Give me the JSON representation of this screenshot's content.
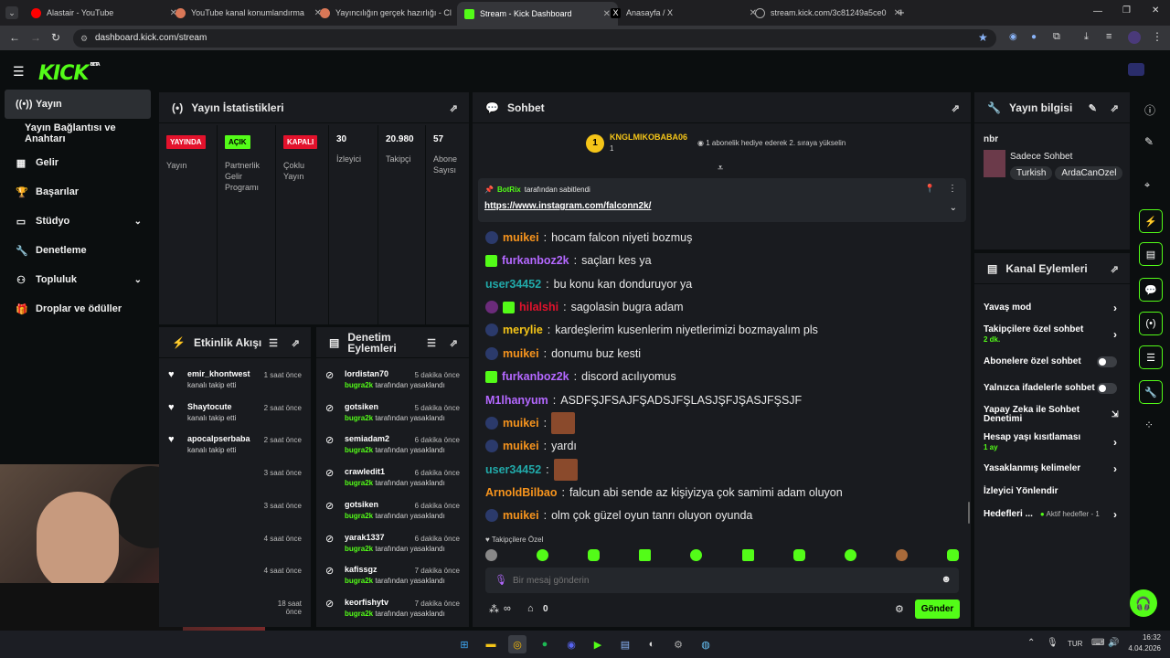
{
  "browser": {
    "tabs": [
      {
        "title": "Alastair - YouTube",
        "color": "#ff0000"
      },
      {
        "title": "YouTube kanal konumlandırma",
        "color": "#d97757"
      },
      {
        "title": "Yayıncılığın gerçek hazırlığı - Cl",
        "color": "#d97757"
      },
      {
        "title": "Stream - Kick Dashboard",
        "color": "#53fc18"
      },
      {
        "title": "Anasayfa / X",
        "color": "#ffffff"
      },
      {
        "title": "stream.kick.com/3c81249a5ce0",
        "color": "#5f6368"
      }
    ],
    "url": "dashboard.kick.com/stream"
  },
  "kick": {
    "logo": "KICK",
    "beta": "BETA"
  },
  "nav": {
    "items": [
      {
        "label": "Yayın",
        "icon": "broadcast-icon"
      },
      {
        "label": "Yayın Bağlantısı ve Anahtarı"
      },
      {
        "label": "Gelir",
        "icon": "chart-icon"
      },
      {
        "label": "Başarılar",
        "icon": "trophy-icon"
      },
      {
        "label": "Stüdyo",
        "icon": "studio-icon"
      },
      {
        "label": "Denetleme",
        "icon": "wrench-icon"
      },
      {
        "label": "Topluluk",
        "icon": "people-icon"
      },
      {
        "label": "Droplar ve ödüller",
        "icon": "gift-icon"
      }
    ]
  },
  "stats": {
    "title": "Yayın İstatistikleri",
    "cells": [
      {
        "badge": "YAYINDA",
        "badge_color": "#e3122c",
        "label": "Yayın"
      },
      {
        "badge": "AÇIK",
        "badge_color": "#53fc18",
        "label": "Partnerlik Gelir Programı"
      },
      {
        "badge": "KAPALI",
        "badge_color": "#e3122c",
        "label": "Çoklu Yayın"
      },
      {
        "value": "30",
        "label": "İzleyici"
      },
      {
        "value": "20.980",
        "label": "Takipçi"
      },
      {
        "value": "57",
        "label": "Abone Sayısı"
      }
    ]
  },
  "activity": {
    "title": "Etkinlik Akışı",
    "rows": [
      {
        "name": "emir_khontwest",
        "sub": "kanalı takip etti",
        "time": "1 saat önce"
      },
      {
        "name": "Shaytocute",
        "sub": "kanalı takip etti",
        "time": "2 saat önce"
      },
      {
        "name": "apocalpserbaba",
        "sub": "kanalı takip etti",
        "time": "2 saat önce"
      },
      {
        "time": "3 saat önce"
      },
      {
        "time": "3 saat önce"
      },
      {
        "time": "4 saat önce"
      },
      {
        "time": "4 saat önce"
      },
      {
        "time": "18 saat önce"
      }
    ]
  },
  "mod": {
    "title": "Denetim Eylemleri",
    "rows": [
      {
        "name": "lordistan70",
        "mod": "bugra2k",
        "sub": "tarafından yasaklandı",
        "time": "5 dakika önce"
      },
      {
        "name": "gotsiken",
        "mod": "bugra2k",
        "sub": "tarafından yasaklandı",
        "time": "5 dakika önce"
      },
      {
        "name": "semiadam2",
        "mod": "bugra2k",
        "sub": "tarafından yasaklandı",
        "time": "6 dakika önce"
      },
      {
        "name": "crawledit1",
        "mod": "bugra2k",
        "sub": "tarafından yasaklandı",
        "time": "6 dakika önce"
      },
      {
        "name": "gotsiken",
        "mod": "bugra2k",
        "sub": "tarafından yasaklandı",
        "time": "6 dakika önce"
      },
      {
        "name": "yarak1337",
        "mod": "bugra2k",
        "sub": "tarafından yasaklandı",
        "time": "6 dakika önce"
      },
      {
        "name": "kafissgz",
        "mod": "bugra2k",
        "sub": "tarafından yasaklandı",
        "time": "7 dakika önce"
      },
      {
        "name": "keorfishytv",
        "mod": "bugra2k",
        "sub": "tarafından yasaklandı",
        "time": "7 dakika önce"
      }
    ]
  },
  "chat": {
    "title": "Sohbet",
    "top_gifter": {
      "rank": "1",
      "name": "KNGLMIKOBABA06",
      "count": "1",
      "note": "1 abonelik hediye ederek 2. sıraya yükselin"
    },
    "pinned": {
      "by": "BotRix",
      "by_suffix": "tarafından sabitlendi",
      "link": "https://www.instagram.com/falconn2k/"
    },
    "messages": [
      {
        "user": "muikei",
        "color": "#f7941d",
        "text": "hocam falcon niyeti bozmuş",
        "badge": "av"
      },
      {
        "user": "furkanboz2k",
        "color": "#b468ff",
        "text": "saçları kes ya",
        "badge": "gift"
      },
      {
        "user": "user34452",
        "color": "#21a9a9",
        "text": "bu konu kan donduruyor ya"
      },
      {
        "user": "hilalshi",
        "color": "#e3122c",
        "text": "sagolasin bugra adam",
        "badge": "av2"
      },
      {
        "user": "merylie",
        "color": "#f5c518",
        "text": "kardeşlerim kusenlerim niyetlerimizi bozmayalım pls",
        "badge": "av"
      },
      {
        "user": "muikei",
        "color": "#f7941d",
        "text": "donumu buz kesti",
        "badge": "av"
      },
      {
        "user": "furkanboz2k",
        "color": "#b468ff",
        "text": "discord acılıyomus",
        "badge": "gift"
      },
      {
        "user": "M1lhanyum",
        "color": "#b468ff",
        "text": "ASDFŞJFSAJFŞADSJFŞLASJŞFJŞASJFŞSJF"
      },
      {
        "user": "muikei",
        "color": "#f7941d",
        "text": "",
        "badge": "av",
        "emote": true
      },
      {
        "user": "muikei",
        "color": "#f7941d",
        "text": "yardı",
        "badge": "av"
      },
      {
        "user": "user34452",
        "color": "#21a9a9",
        "text": "",
        "emote": true
      },
      {
        "user": "ArnoldBilbao",
        "color": "#f7941d",
        "text": "falcun abi sende az kişiyizya çok samimi adam oluyon"
      },
      {
        "user": "muikei",
        "color": "#f7941d",
        "text": "olm çok güzel oyun tanrı oluyon oyunda",
        "badge": "av"
      }
    ],
    "followers_only": "Takipçilere Özel",
    "placeholder": "Bir mesaj gönderin",
    "points": "0",
    "send": "Gönder"
  },
  "info": {
    "title": "Yayın bilgisi",
    "stream_title": "nbr",
    "category": "Sadece Sohbet",
    "tags": [
      "Turkish",
      "ArdaCanOzel"
    ]
  },
  "actions": {
    "title": "Kanal Eylemleri",
    "rows": [
      {
        "label": "Yavaş mod"
      },
      {
        "label": "Takipçilere özel sohbet",
        "sub": "2 dk."
      },
      {
        "label": "Abonelere özel sohbet"
      },
      {
        "label": "Yalnızca ifadelerle sohbet"
      },
      {
        "label": "Yapay Zeka ile Sohbet Denetimi"
      },
      {
        "label": "Hesap yaşı kısıtlaması",
        "sub": "1 ay"
      },
      {
        "label": "Yasaklanmış kelimeler"
      },
      {
        "label": "İzleyici Yönlendir"
      },
      {
        "label": "Hedefleri ...",
        "sub": "Aktif hedefler - 1"
      }
    ]
  },
  "taskbar": {
    "lang": "TUR",
    "time": "16:32",
    "date": "4.04.2026"
  }
}
